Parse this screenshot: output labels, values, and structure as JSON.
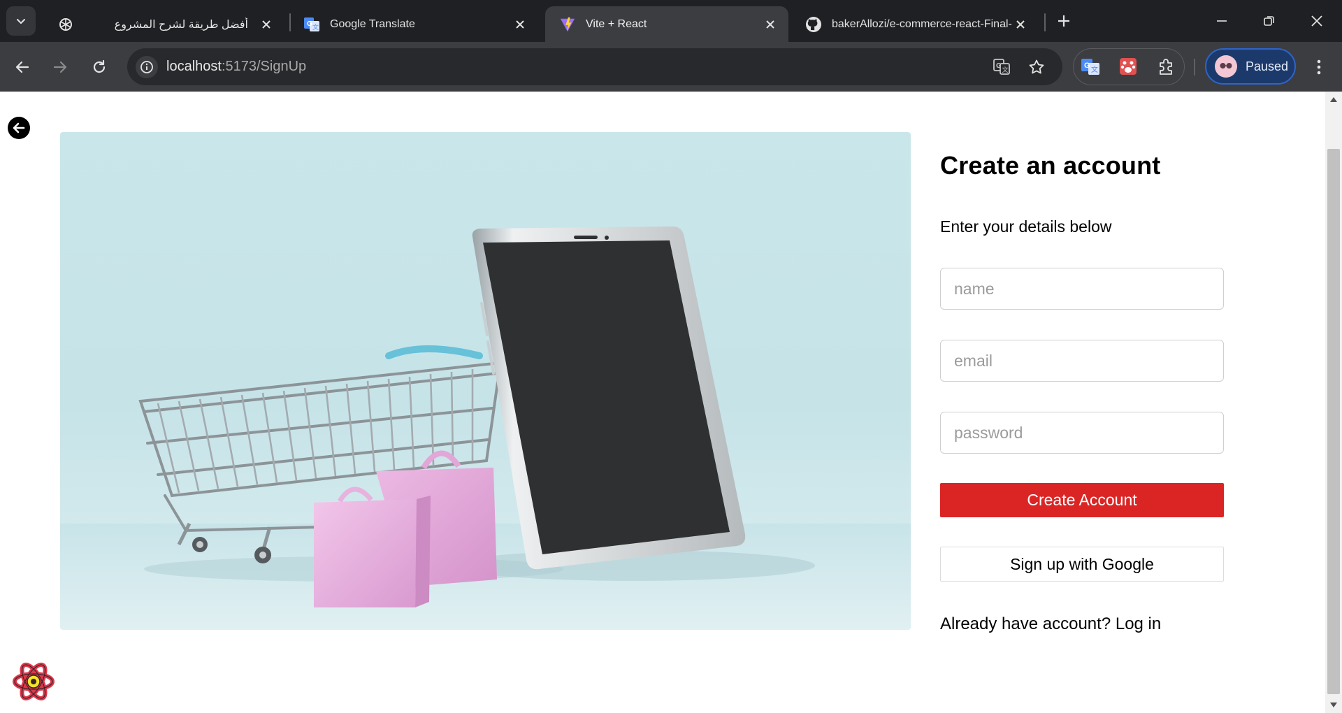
{
  "browser": {
    "tabs": [
      {
        "title": "أفضل طريقة لشرح المشروع",
        "icon": "chatgpt-icon"
      },
      {
        "title": "Google Translate",
        "icon": "google-translate-icon"
      },
      {
        "title": "Vite + React",
        "icon": "vite-icon",
        "active": true
      },
      {
        "title": "bakerAllozi/e-commerce-react-Final-v",
        "icon": "github-icon"
      }
    ],
    "url_host": "localhost",
    "url_path": ":5173/SignUp",
    "profile_label": "Paused"
  },
  "page": {
    "back_icon": "arrow-left-icon",
    "hero_image": "shopping-cart-and-smartphone-illustration",
    "form": {
      "title": "Create an account",
      "subtitle": "Enter your details below",
      "name_placeholder": "name",
      "email_placeholder": "email",
      "password_placeholder": "password",
      "create_button": "Create Account",
      "google_button": "Sign up with Google",
      "login_prompt": "Already have account?",
      "login_link": "Log in"
    },
    "corner_icon": "react-dev-tools-icon"
  },
  "colors": {
    "accent_red": "#db2525",
    "chrome_dark": "#1f2023",
    "toolbar": "#3c3d41",
    "hero_bg": "#c9e6ea"
  }
}
